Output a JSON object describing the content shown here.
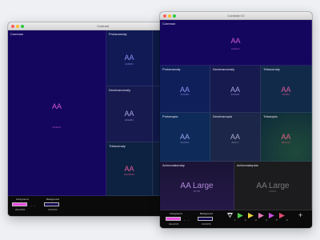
{
  "window_left": {
    "title": "Contrast",
    "cells": {
      "common": {
        "name": "Common",
        "sample": "AA",
        "hex": "#A32A1"
      },
      "protanomaly": {
        "name": "Protanomaly",
        "sample": "AA",
        "hex": "#A9FB1"
      },
      "deuteranomaly": {
        "name": "Deuteranomaly",
        "sample": "AA",
        "hex": "#A9AB1"
      },
      "tritanomaly": {
        "name": "Tritanomaly",
        "sample": "AA",
        "hex": "#DA9FB1"
      }
    },
    "footer": {
      "foreground_label": "Foreground",
      "foreground_hex": "#ELE506",
      "background_label": "Background",
      "background_hex": "#100050",
      "swap": "← →"
    }
  },
  "window_right": {
    "title": "Contrast V2",
    "cells": {
      "common": {
        "name": "Common",
        "sample": "AA",
        "hex": "#A32A1"
      },
      "protanomaly": {
        "name": "Protanomaly",
        "sample": "AA",
        "hex": "#A0FB1"
      },
      "deuteranomaly": {
        "name": "Deuteranomaly",
        "sample": "AA",
        "hex": "#A3A91"
      },
      "tritanomaly": {
        "name": "Tritanomaly",
        "sample": "AA",
        "hex": "#A9B1"
      },
      "protanopia": {
        "name": "Protanopia",
        "sample": "AA",
        "hex": "#C2A91"
      },
      "deuteranopia": {
        "name": "Deuteranopia",
        "sample": "AA",
        "hex": "#AA71"
      },
      "tritanopia": {
        "name": "Tritanopia",
        "sample": "AA",
        "hex": "#EAA21"
      },
      "achromatomaly": {
        "name": "Achromatomaly",
        "sample": "AA Large",
        "hex": "#7791"
      },
      "achromatopsia": {
        "name": "Achromatopsia",
        "sample": "AA Large",
        "hex": "#A891"
      }
    },
    "footer": {
      "foreground_label": "Foreground",
      "foreground_hex": "#ELE506",
      "background_label": "Background",
      "background_hex": "#100050",
      "swap": "← →"
    },
    "toolbar": {
      "filters": [
        {
          "icon": "filter-triangle-white-icon",
          "num": "1"
        },
        {
          "icon": "filter-triangle-green-icon",
          "num": "2"
        },
        {
          "icon": "filter-triangle-yellow-icon",
          "num": "3"
        },
        {
          "icon": "filter-triangle-pink-icon",
          "num": "4"
        },
        {
          "icon": "filter-triangle-magenta-icon",
          "num": "5"
        },
        {
          "icon": "filter-triangle-red-icon",
          "num": "6"
        }
      ],
      "add_label": "+"
    }
  },
  "colors": {
    "foreground": "#e94ce0",
    "background": "#100050",
    "protanomaly_text": "#8a8ef0",
    "deuteranomaly_text": "#a7a2e0",
    "tritanomaly_text": "#e05b97",
    "protanopia_text": "#9aa3ee",
    "deuteranopia_text": "#a7a7c8",
    "tritanopia_text": "#e06682",
    "achromatomaly_text": "#b088d8",
    "achromatopsia_text": "#7a7a7a"
  }
}
